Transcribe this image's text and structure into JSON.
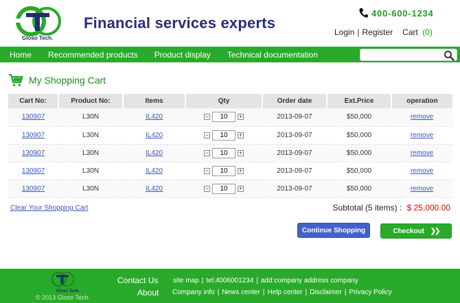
{
  "header": {
    "logo_text": "Gloso Tech.",
    "title": "Financial services experts",
    "phone": "400-600-1234",
    "login": "Login",
    "separator": "|",
    "register": "Register",
    "cart_label": "Cart",
    "cart_count": "(0)"
  },
  "nav": {
    "items": [
      "Home",
      "Recommended products",
      "Product display",
      "Technical documentation"
    ],
    "search_placeholder": "",
    "search_value": ""
  },
  "cart": {
    "title": "My Shopping Cart",
    "columns": [
      "Cart No:",
      "Product No:",
      "Items",
      "Qty",
      "Order date",
      "Ext.Price",
      "operation"
    ],
    "rows": [
      {
        "cart_no": "130907",
        "product_no": "L30N",
        "item": "IL420",
        "qty": "10",
        "date": "2013-09-07",
        "price": "$50,000",
        "op": "remove"
      },
      {
        "cart_no": "130907",
        "product_no": "L30N",
        "item": "IL420",
        "qty": "10",
        "date": "2013-09-07",
        "price": "$50,000",
        "op": "remove"
      },
      {
        "cart_no": "130907",
        "product_no": "L30N",
        "item": "IL420",
        "qty": "10",
        "date": "2013-09-07",
        "price": "$50,000",
        "op": "remove"
      },
      {
        "cart_no": "130907",
        "product_no": "L30N",
        "item": "IL420",
        "qty": "10",
        "date": "2013-09-07",
        "price": "$50,000",
        "op": "remove"
      },
      {
        "cart_no": "130907",
        "product_no": "L30N",
        "item": "IL420",
        "qty": "10",
        "date": "2013-09-07",
        "price": "$50,000",
        "op": "remove"
      }
    ],
    "qty_minus": "−",
    "qty_plus": "+",
    "clear_label": "Clear Your Shopping Cart",
    "subtotal_label": "Subtotal (5 items) :",
    "subtotal_amount": "$ 25,000.00",
    "continue_label": "Continue Shopping",
    "checkout_label": "Checkout",
    "checkout_arrows": "❯❯"
  },
  "footer": {
    "logo_text": "Gloso Tech.",
    "copyright": "© 2013 Gloso Tech.",
    "contact_label": "Contact Us",
    "about_label": "About",
    "site_map": "site map",
    "tel": "tel:4006001234",
    "address": "add:company address company",
    "links": [
      "Company info",
      "News center",
      "Help center",
      "Disclaimer",
      "Privacy Policy"
    ],
    "separator": "|"
  },
  "colors": {
    "brand_green": "#2aaa2a",
    "title_blue": "#2a2d7a",
    "link_blue": "#3a55b8",
    "price_red": "#e60000",
    "continue_blue": "#4660c9"
  },
  "icons": [
    "phone-icon",
    "search-icon",
    "cart-icon",
    "logo-mark"
  ]
}
